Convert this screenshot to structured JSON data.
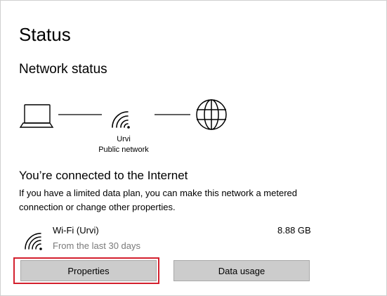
{
  "page": {
    "title": "Status"
  },
  "network_status": {
    "heading": "Network status",
    "diagram": {
      "device_icon": "laptop-icon",
      "connection_icon": "wifi-icon",
      "internet_icon": "globe-icon",
      "network_name": "Urvi",
      "network_type": "Public network"
    }
  },
  "connection": {
    "title": "You’re connected to the Internet",
    "description": "If you have a limited data plan, you can make this network a metered connection or change other properties."
  },
  "adapter": {
    "icon": "wifi-icon",
    "name": "Wi-Fi (Urvi)",
    "period": "From the last 30 days",
    "usage": "8.88 GB"
  },
  "buttons": {
    "properties_label": "Properties",
    "data_usage_label": "Data usage"
  },
  "colors": {
    "highlight": "#d3202e",
    "button_bg": "#cccccc",
    "muted_text": "#7a7a7a"
  }
}
